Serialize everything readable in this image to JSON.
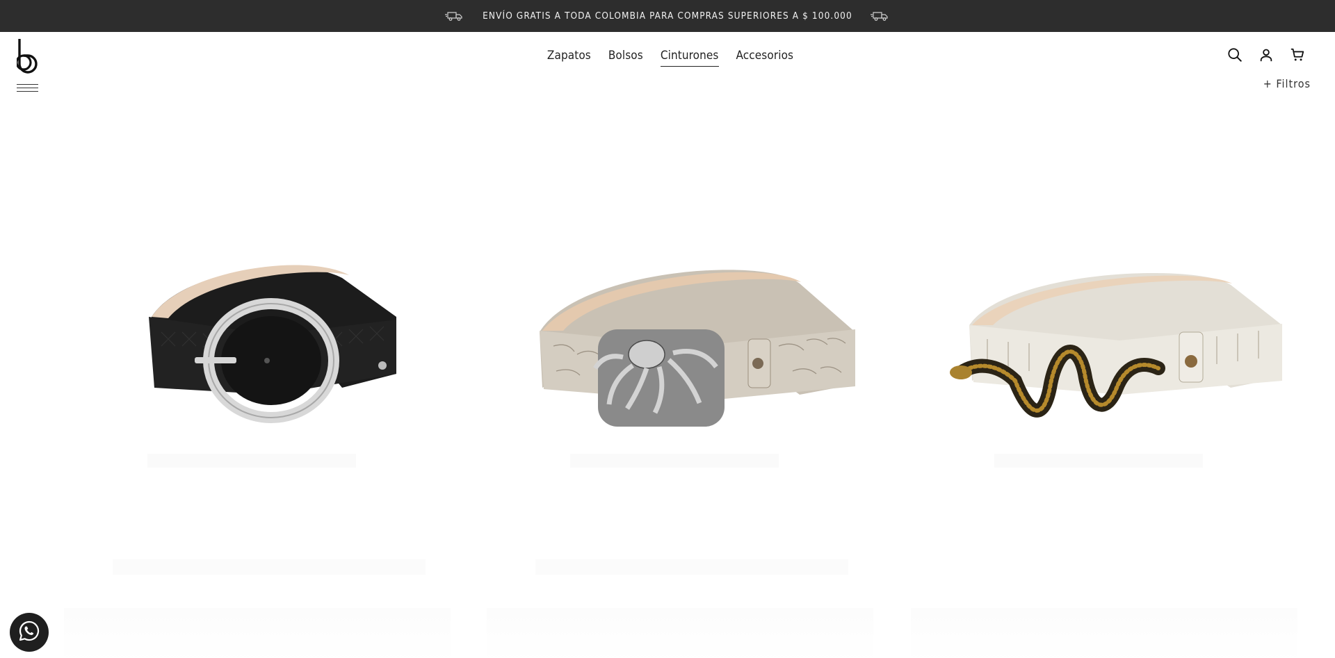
{
  "announcement": {
    "text": "ENVÍO GRATIS A TODA COLOMBIA PARA COMPRAS SUPERIORES A $ 100.000",
    "icon": "delivery-truck-icon"
  },
  "header": {
    "logo": "b",
    "nav": [
      {
        "label": "Zapatos",
        "active": false
      },
      {
        "label": "Bolsos",
        "active": false
      },
      {
        "label": "Cinturones",
        "active": true
      },
      {
        "label": "Accesorios",
        "active": false
      }
    ],
    "icons": [
      "search-icon",
      "user-icon",
      "cart-icon"
    ],
    "filters_label": "+ Filtros"
  },
  "products": [
    {
      "image": "belt-black-snake-heart-buckle",
      "colors": {
        "strap": "#1b1b1b",
        "buckle": "#d9d9d9",
        "lining": "#e8d2bd"
      }
    },
    {
      "image": "belt-grey-croco-octopus-buckle",
      "colors": {
        "strap": "#cfc7bb",
        "buckle": "#8d8d8d",
        "lining": "#e6ccb3"
      }
    },
    {
      "image": "belt-white-croco-serpent-buckle",
      "colors": {
        "strap": "#e9e6de",
        "buckle": "#2a2418",
        "lining": "#ecd8c2"
      }
    }
  ],
  "accent": {
    "dark": "#2d2d2d",
    "whatsapp_bg": "#1f1f1f"
  }
}
